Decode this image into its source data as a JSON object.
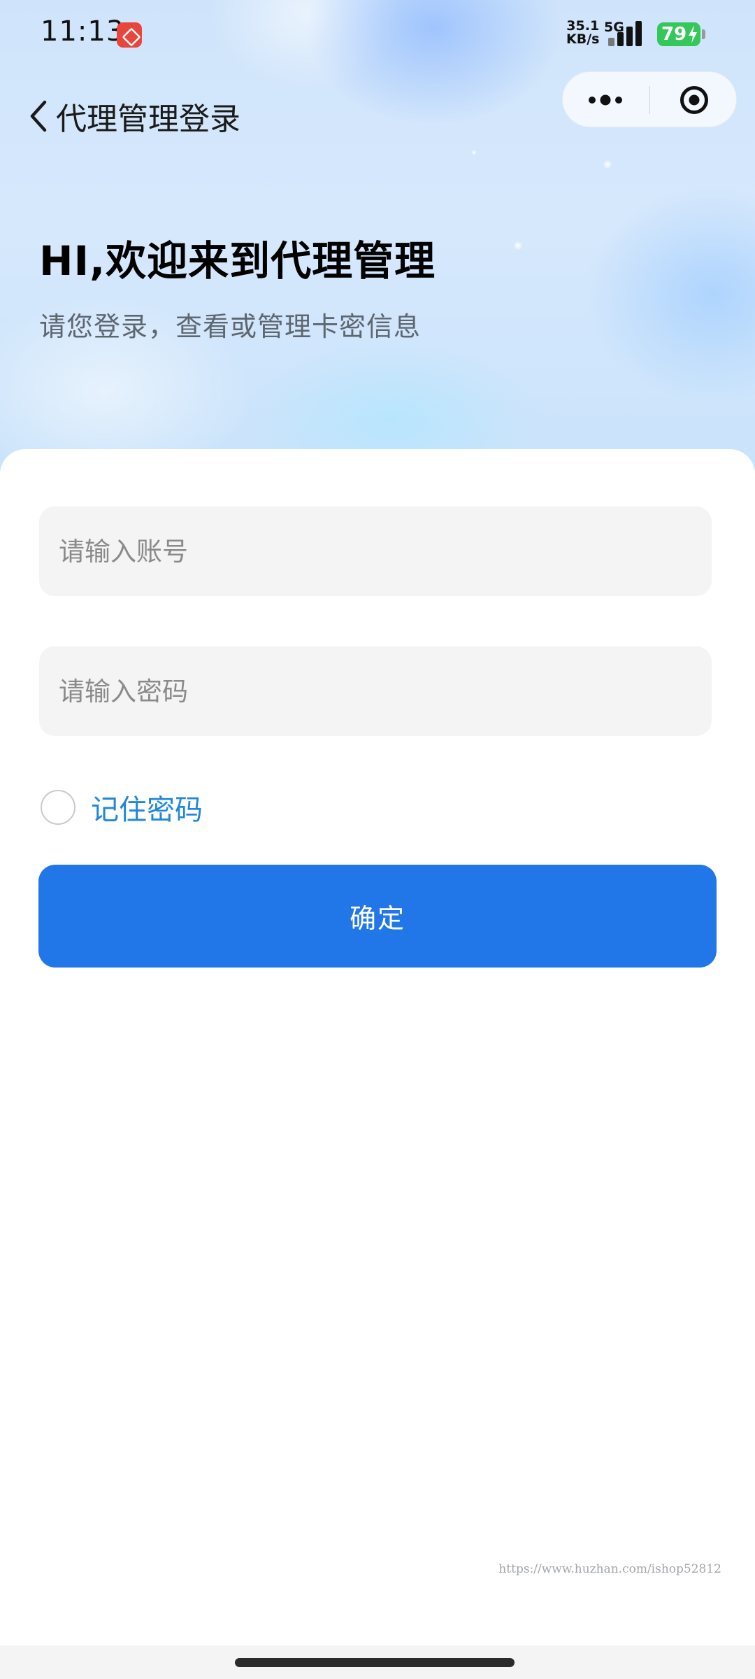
{
  "status_bar": {
    "time": "11:13",
    "net_speed_value": "35.1",
    "net_speed_unit": "KB/s",
    "network_type": "5G",
    "battery": "79",
    "app_badge_icon": "red-app-notification-icon",
    "battery_color": "#34c759"
  },
  "nav": {
    "back_icon": "chevron-left-icon",
    "title": "代理管理登录",
    "more_icon": "more-dots-icon",
    "close_icon": "target-circle-icon"
  },
  "hero": {
    "headline": "HI,欢迎来到代理管理",
    "subtitle": "请您登录，查看或管理卡密信息"
  },
  "form": {
    "account_placeholder": "请输入账号",
    "account_value": "",
    "password_placeholder": "请输入密码",
    "password_value": "",
    "remember_label": "记住密码",
    "remember_checked": false,
    "submit_label": "确定"
  },
  "watermark": "https://www.huzhan.com/ishop52812",
  "colors": {
    "primary": "#2176e8",
    "link": "#1f88d8",
    "field_bg": "#f4f4f4"
  }
}
